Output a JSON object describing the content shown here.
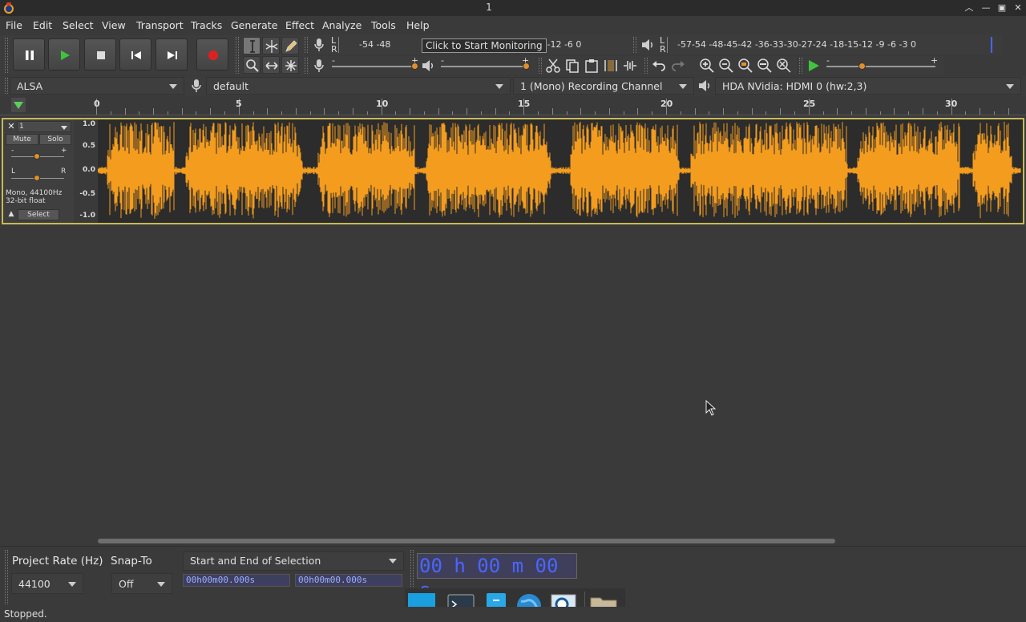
{
  "window": {
    "title": "1"
  },
  "menu": [
    "File",
    "Edit",
    "Select",
    "View",
    "Transport",
    "Tracks",
    "Generate",
    "Effect",
    "Analyze",
    "Tools",
    "Help"
  ],
  "record_meter": {
    "lr_label_l": "L",
    "lr_label_r": "R",
    "scale_left": "-54   -48",
    "scale_right": "8   -12     -6     0",
    "tooltip": "Click to Start Monitoring"
  },
  "play_meter": {
    "lr_label_l": "L",
    "lr_label_r": "R",
    "scale": "-57-54    -48-45-42    -36-33-30-27-24    -18-15-12  -9  -6  -3  0"
  },
  "sliders": {
    "rec_minus": "-",
    "rec_plus": "+",
    "play_minus": "-",
    "play_plus": "+",
    "speed_minus": "-",
    "speed_plus": "+"
  },
  "device": {
    "host": "ALSA",
    "recording_device": "default",
    "channels": "1 (Mono) Recording Channel",
    "playback_device": "HDA NVidia: HDMI 0 (hw:2,3)"
  },
  "ruler": {
    "labels": [
      "0",
      "5",
      "10",
      "15",
      "20",
      "25",
      "30"
    ]
  },
  "track": {
    "name": "1",
    "mute_label": "Mute",
    "solo_label": "Solo",
    "gain_minus": "-",
    "gain_plus": "+",
    "pan_left": "L",
    "pan_right": "R",
    "info_line1": "Mono, 44100Hz",
    "info_line2": "32-bit float",
    "select_label": "Select",
    "vruler": [
      "1.0",
      "0.5",
      "0.0",
      "-0.5",
      "-1.0"
    ],
    "wave_color": "#f39c1e"
  },
  "selection_toolbar": {
    "rate_label": "Project Rate (Hz)",
    "rate_value": "44100",
    "snap_label": "Snap-To",
    "snap_value": "Off",
    "selection_mode": "Start and End of Selection",
    "start_time": "00h00m00.000s",
    "end_time": "00h00m00.000s",
    "audio_position": "00 h 00 m 00 s"
  },
  "status": {
    "text": "Stopped."
  }
}
